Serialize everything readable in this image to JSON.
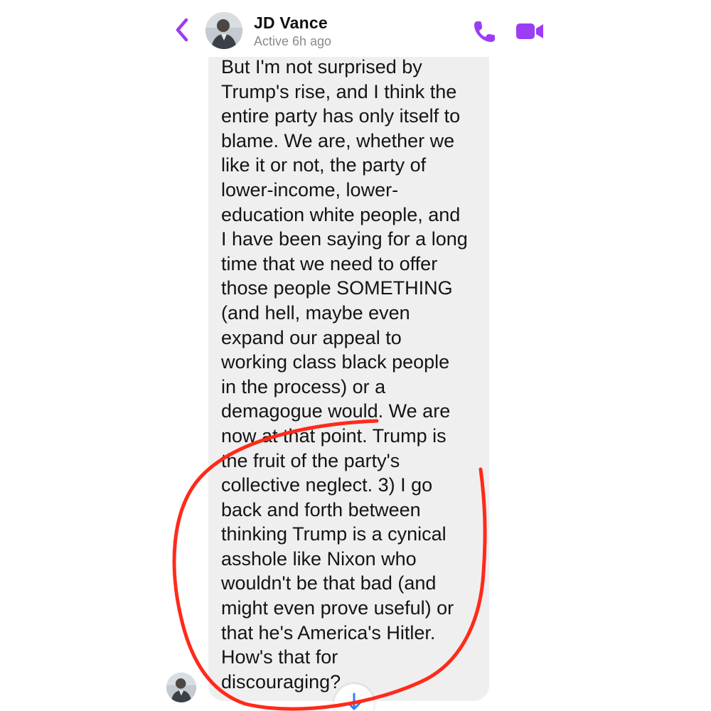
{
  "header": {
    "contact_name": "JD Vance",
    "status": "Active 6h ago",
    "back_icon": "chevron-left-icon",
    "call_icon": "phone-icon",
    "video_icon": "video-camera-icon"
  },
  "message": {
    "lines": [
      "But I'm not surprised by",
      "Trump's rise, and I think the",
      "entire party has only itself to",
      "blame.  We are, whether we",
      "like it or not, the party of",
      "lower-income, lower-",
      "education white people, and",
      "I have been saying for a long",
      "time that we need to offer",
      "those people SOMETHING",
      "(and hell, maybe even",
      "expand our appeal to",
      "working class black people",
      "in the process) or a",
      "demagogue would.  We are",
      "now at that point.  Trump is",
      "the fruit of the party's",
      "collective neglect.  3) I go",
      "back and forth between",
      "thinking Trump is a cynical",
      "asshole like Nixon who",
      "wouldn't be that bad (and",
      "might even prove useful) or",
      "that he's America's Hitler.",
      "How's that for",
      "discouraging?"
    ]
  },
  "scroll_icon": "arrow-down-icon",
  "colors": {
    "accent": "#9b3df4",
    "bubble": "#efefef",
    "annotation": "#ff2a1a",
    "scroll_arrow": "#2f7df6"
  }
}
